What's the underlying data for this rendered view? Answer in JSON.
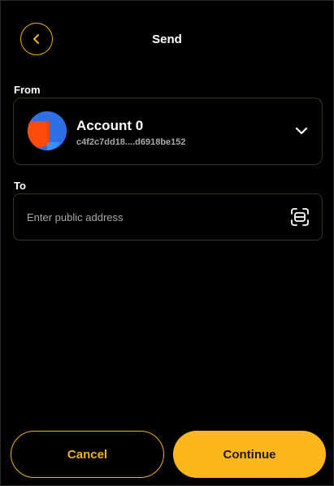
{
  "header": {
    "title": "Send",
    "back_icon": "chevron-left-icon"
  },
  "from": {
    "label": "From",
    "account_name": "Account 0",
    "account_address": "c4f2c7dd18....d6918be152",
    "expand_icon": "chevron-down-icon"
  },
  "to": {
    "label": "To",
    "placeholder": "Enter public address",
    "value": "",
    "scan_icon": "qr-scan-icon"
  },
  "footer": {
    "cancel_label": "Cancel",
    "continue_label": "Continue"
  },
  "colors": {
    "accent": "#f2b01e",
    "primary_button": "#fdb71c",
    "background": "#000000",
    "avatar_blue": "#2f6fe6",
    "avatar_orange": "#ff4a0a"
  }
}
